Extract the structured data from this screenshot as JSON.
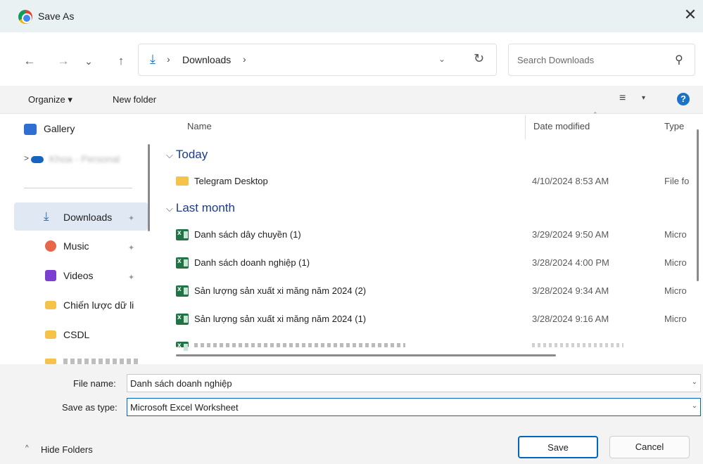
{
  "window": {
    "title": "Save As",
    "close_symbol": "✕"
  },
  "nav": {
    "back_symbol": "←",
    "forward_symbol": "→",
    "recent_symbol": "⌄",
    "up_symbol": "↑",
    "address_sep": "›",
    "address_folder": "Downloads",
    "address_sep2": "›",
    "address_dropdown": "⌄",
    "refresh_symbol": "↻",
    "search_placeholder": "Search Downloads",
    "search_symbol": "⚲"
  },
  "toolbar": {
    "organize_label": "Organize ▾",
    "new_folder_label": "New folder",
    "view_symbol": "≡",
    "view_arrow": "▾",
    "help_symbol": "?"
  },
  "sidebar": {
    "items": [
      {
        "label": "Gallery",
        "icon": "gallery-icon",
        "color": "#2e6fd1"
      },
      {
        "label": "Khoa - Personal",
        "icon": "onedrive-icon",
        "color": "#1565c0"
      },
      {
        "label": "Downloads",
        "icon": "download-icon",
        "color": "#1a73c8",
        "pinned": true
      },
      {
        "label": "Music",
        "icon": "music-icon",
        "color": "#e8664a",
        "pinned": true
      },
      {
        "label": "Videos",
        "icon": "videos-icon",
        "color": "#7b3fd1",
        "pinned": true
      },
      {
        "label": "Chiến lược dữ li",
        "icon": "folder-icon",
        "color": "#f6c34a"
      },
      {
        "label": "CSDL",
        "icon": "folder-icon",
        "color": "#f6c34a"
      }
    ],
    "expand_symbol": ">",
    "pin_symbol": "✦"
  },
  "columns": {
    "name": "Name",
    "date": "Date modified",
    "type": "Type",
    "sort_symbol": "⌃"
  },
  "groups": [
    {
      "label": "Today",
      "chev": "⌵"
    },
    {
      "label": "Last month",
      "chev": "⌵"
    }
  ],
  "files": [
    {
      "name": "Telegram Desktop",
      "date": "4/10/2024 8:53 AM",
      "type": "File fo",
      "kind": "folder"
    },
    {
      "name": "Danh sách dây chuyền (1)",
      "date": "3/29/2024 9:50 AM",
      "type": "Micro",
      "kind": "excel"
    },
    {
      "name": "Danh sách doanh nghiệp (1)",
      "date": "3/28/2024 4:00 PM",
      "type": "Micro",
      "kind": "excel"
    },
    {
      "name": "Sản lượng sản xuất xi măng năm 2024 (2)",
      "date": "3/28/2024 9:34 AM",
      "type": "Micro",
      "kind": "excel"
    },
    {
      "name": "Sản lượng sản xuất xi măng năm 2024 (1)",
      "date": "3/28/2024 9:16 AM",
      "type": "Micro",
      "kind": "excel"
    }
  ],
  "form": {
    "file_name_label": "File name:",
    "file_name_value": "Danh sách doanh nghiệp",
    "save_type_label": "Save as type:",
    "save_type_value": "Microsoft Excel Worksheet",
    "dropdown_symbol": "⌄"
  },
  "footer": {
    "hide_folders_label": "Hide Folders",
    "hide_arrow": "^",
    "save_label": "Save",
    "cancel_label": "Cancel"
  }
}
